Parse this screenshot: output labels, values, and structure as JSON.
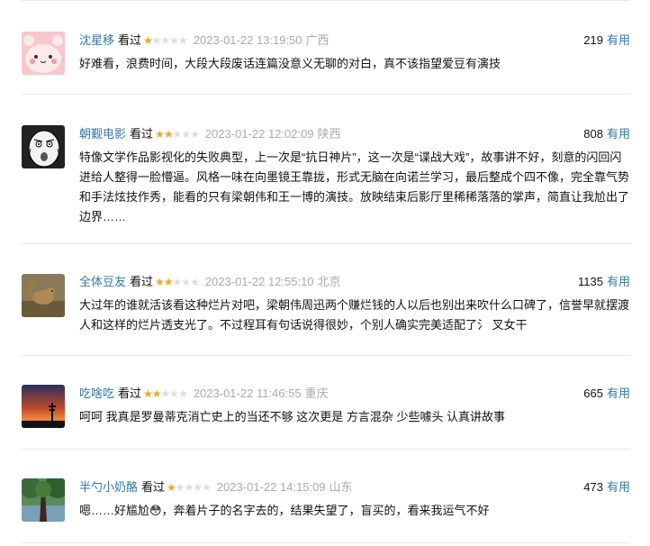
{
  "labels": {
    "watched": "看过",
    "useful": "有用"
  },
  "colors": {
    "link": "#3377aa",
    "star": "#f5a623",
    "meta": "#aaaaaa"
  },
  "reviews": [
    {
      "username": "沈星移",
      "rating": 1,
      "max_rating": 5,
      "time": "2023-01-22 13:19:50",
      "location": "广西",
      "votes": "219",
      "avatar_icon": "pink-cat-avatar-icon",
      "text": "好难看，浪费时间，大段大段废话连篇没意义无聊的对白，真不该指望爱豆有演技"
    },
    {
      "username": "朝觐电影",
      "rating": 2,
      "max_rating": 5,
      "time": "2023-01-22 12:02:09",
      "location": "陕西",
      "votes": "808",
      "avatar_icon": "rage-face-avatar-icon",
      "text": "特像文学作品影视化的失败典型，上一次是“抗日神片”，这一次是“谍战大戏”，故事讲不好，刻意的闪回闪进给人整得一脸懵逼。风格一味在向墨镜王靠拢，形式无脑在向诺兰学习，最后整成个四不像，完全靠气势和手法炫技作秀，能看的只有梁朝伟和王一博的演技。放映结束后影厅里稀稀落落的掌声，简直让我尬出了边界……"
    },
    {
      "username": "全体豆友",
      "rating": 2,
      "max_rating": 5,
      "time": "2023-01-22 12:55:10",
      "location": "北京",
      "votes": "1135",
      "avatar_icon": "squirrel-photo-avatar-icon",
      "text": "大过年的谁就活该看这种烂片对吧，梁朝伟周迅两个赚烂钱的人以后也别出来吹什么口碑了，信誉早就摆渡人和这样的烂片透支光了。不过程耳有句话说得很妙，个别人确实完美适配了氵 叉女干"
    },
    {
      "username": "吃啥吃",
      "rating": 2,
      "max_rating": 5,
      "time": "2023-01-22 11:46:55",
      "location": "重庆",
      "votes": "665",
      "avatar_icon": "sunset-photo-avatar-icon",
      "text": "呵呵 我真是罗曼蒂克消亡史上的当还不够 这次更是 方言混杂 少些噱头 认真讲故事"
    },
    {
      "username": "半勺小奶酪",
      "rating": 1,
      "max_rating": 5,
      "time": "2023-01-22 14:15:09",
      "location": "山东",
      "votes": "473",
      "avatar_icon": "forest-photo-avatar-icon",
      "text": "嗯……好尴尬😳，奔着片子的名字去的，结果失望了，盲买的，看来我运气不好"
    }
  ]
}
